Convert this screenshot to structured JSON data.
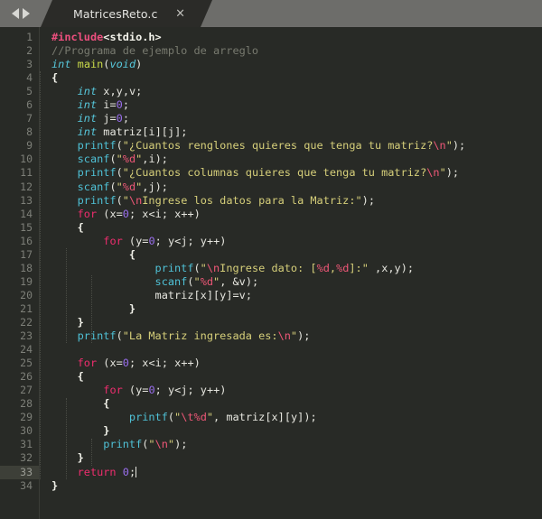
{
  "window": {
    "tab_nav": {
      "prev_label": "◀",
      "next_label": "▶"
    },
    "tab": {
      "title": "MatricesReto.c",
      "close_label": "×"
    },
    "colors": {
      "tabbar_bg": "#6d6d6a",
      "tab_bg": "#2b2b28",
      "editor_bg": "#282a26",
      "gutter_text": "#7d7f78",
      "active_line_bg": "#3d3f38",
      "default_text": "#e6e6df",
      "preprocessor": "#ec4f7e",
      "comment": "#787a6f",
      "type": "#57c8dc",
      "function_name": "#c9d94a",
      "function_call": "#4fc1d6",
      "string": "#d6cf7a",
      "escape": "#ef5777",
      "keyword": "#ef2d6e",
      "number": "#9b6ff0"
    }
  },
  "editor": {
    "language": "C",
    "active_line": 33,
    "total_lines": 34,
    "cursor": {
      "line": 33,
      "column": 14
    },
    "line_numbers": [
      1,
      2,
      3,
      4,
      5,
      6,
      7,
      8,
      9,
      10,
      11,
      12,
      13,
      14,
      15,
      16,
      17,
      18,
      19,
      20,
      21,
      22,
      23,
      24,
      25,
      26,
      27,
      28,
      29,
      30,
      31,
      32,
      33,
      34
    ],
    "lines": [
      "#include<stdio.h>",
      "//Programa de ejemplo de arreglo",
      "int main(void)",
      "{",
      "    int x,y,v;",
      "    int i=0;",
      "    int j=0;",
      "    int matriz[i][j];",
      "    printf(\"¿Cuantos renglones quieres que tenga tu matriz?\\n\");",
      "    scanf(\"%d\",i);",
      "    printf(\"¿Cuantos columnas quieres que tenga tu matriz?\\n\");",
      "    scanf(\"%d\",j);",
      "    printf(\"\\nIngrese los datos para la Matriz:\");",
      "    for (x=0; x<i; x++)",
      "    {",
      "        for (y=0; y<j; y++)",
      "            {",
      "                printf(\"\\nIngrese dato: [%d,%d]:\" ,x,y);",
      "                scanf(\"%d\", &v);",
      "                matriz[x][y]=v;",
      "            }",
      "    }",
      "    printf(\"La Matriz ingresada es:\\n\");",
      "",
      "    for (x=0; x<i; x++)",
      "    {",
      "        for (y=0; y<j; y++)",
      "        {",
      "            printf(\"\\t%d\", matriz[x][y]);",
      "        }",
      "        printf(\"\\n\");",
      "    }",
      "    return 0;",
      "}"
    ]
  }
}
